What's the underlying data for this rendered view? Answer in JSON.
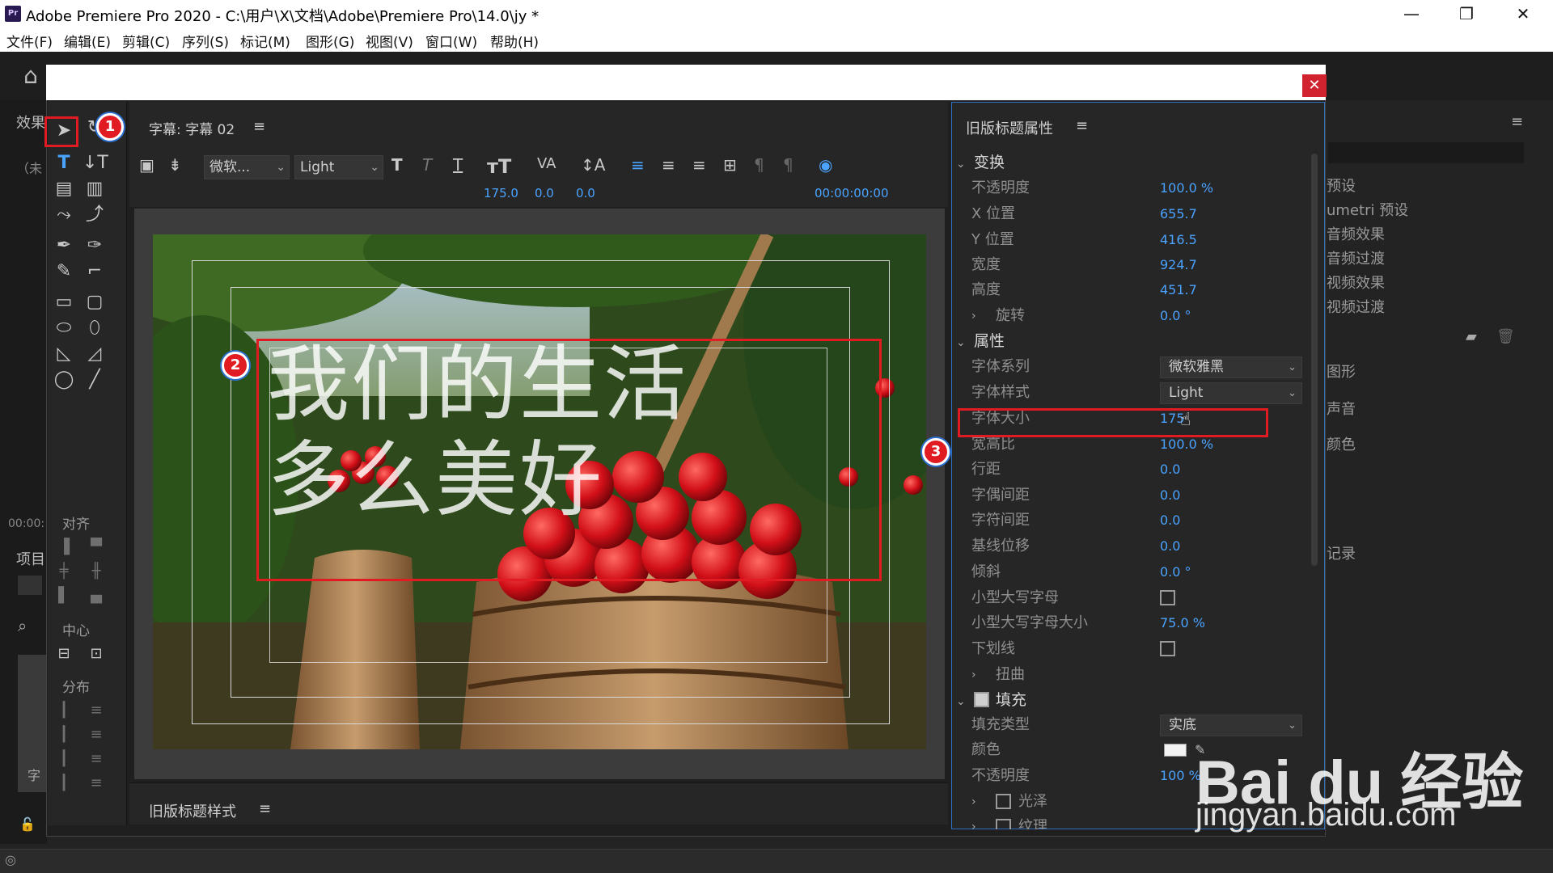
{
  "window": {
    "app_icon": "Pr",
    "title": "Adobe Premiere Pro 2020 - C:\\用户\\X\\文档\\Adobe\\Premiere Pro\\14.0\\jy *",
    "minimize": "—",
    "maximize": "❐",
    "close": "✕"
  },
  "menu": [
    "文件(F)",
    "编辑(E)",
    "剪辑(C)",
    "序列(S)",
    "标记(M)",
    "图形(G)",
    "视图(V)",
    "窗口(W)",
    "帮助(H)"
  ],
  "background": {
    "left_tab": "效果",
    "left_search": "（未",
    "left_time": "00:00:",
    "left_project_tab": "项目",
    "left_bottom_label": "字",
    "right_list": [
      "预设",
      "umetri 预设",
      "音频效果",
      "音频过渡",
      "视频效果",
      "视频过渡",
      "图形",
      "声音",
      "颜色",
      "记录"
    ]
  },
  "tools_panel": {
    "align_label": "对齐",
    "center_label": "中心",
    "distribute_label": "分布"
  },
  "title_panel": {
    "title": "字幕: 字幕 02",
    "font_family": "微软...",
    "font_style": "Light",
    "font_size": "175.0",
    "kerning": "0.0",
    "leading": "0.0",
    "timecode": "00:00:00:00",
    "title_line1": "我们的生活",
    "title_line2": "多么美好"
  },
  "styles_panel": {
    "title": "旧版标题样式"
  },
  "properties": {
    "panel_title": "旧版标题属性",
    "transform": {
      "header": "变换",
      "opacity_label": "不透明度",
      "opacity": "100.0 %",
      "x_label": "X 位置",
      "x": "655.7",
      "y_label": "Y 位置",
      "y": "416.5",
      "width_label": "宽度",
      "width": "924.7",
      "height_label": "高度",
      "height": "451.7",
      "rotation_label": "旋转",
      "rotation": "0.0 °"
    },
    "attributes": {
      "header": "属性",
      "font_family_label": "字体系列",
      "font_family": "微软雅黑",
      "font_style_label": "字体样式",
      "font_style": "Light",
      "font_size_label": "字体大小",
      "font_size": "175",
      "aspect_label": "宽高比",
      "aspect": "100.0 %",
      "leading_label": "行距",
      "leading": "0.0",
      "kerning_label": "字偶间距",
      "kerning": "0.0",
      "tracking_label": "字符间距",
      "tracking": "0.0",
      "baseline_label": "基线位移",
      "baseline": "0.0",
      "slant_label": "倾斜",
      "slant": "0.0 °",
      "smallcaps_label": "小型大写字母",
      "smallcaps_size_label": "小型大写字母大小",
      "smallcaps_size": "75.0 %",
      "underline_label": "下划线",
      "distort_label": "扭曲"
    },
    "fill": {
      "header": "填充",
      "fill_type_label": "填充类型",
      "fill_type": "实底",
      "color_label": "颜色",
      "color": "#f2f2f2",
      "opacity_label": "不透明度",
      "opacity": "100 %",
      "sheen_label": "光泽",
      "texture_label": "纹理"
    }
  },
  "annotations": {
    "badge1": "1",
    "badge2": "2",
    "badge3": "3",
    "color": "#e11b22"
  },
  "watermark": {
    "brand": "Bai du 经验",
    "url": "jingyan.baidu.com"
  }
}
